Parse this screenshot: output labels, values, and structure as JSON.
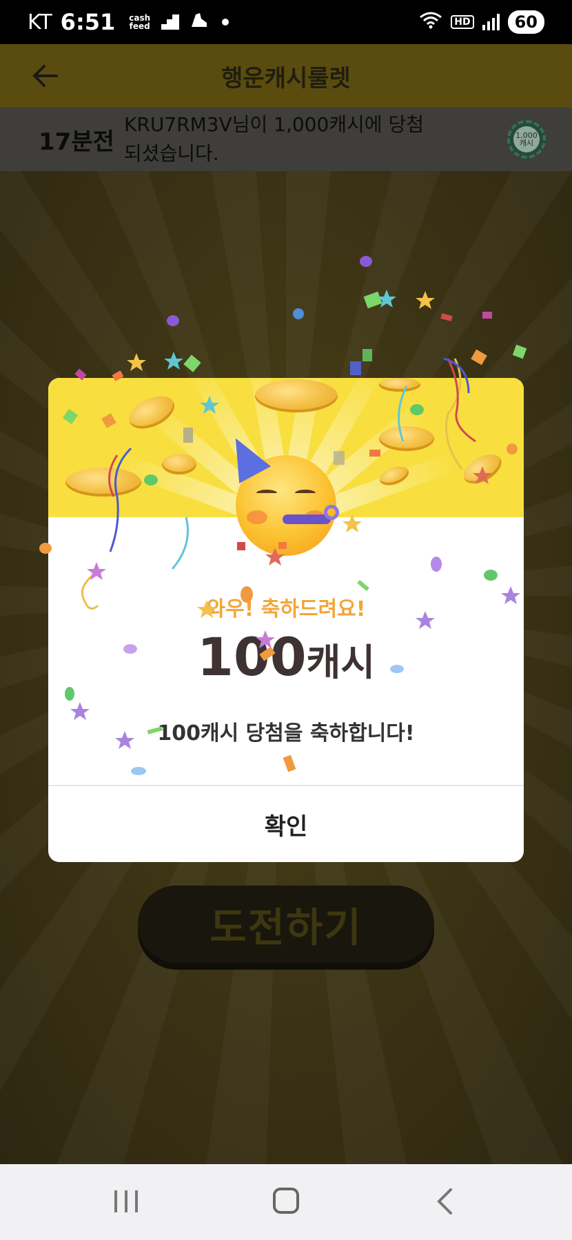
{
  "status_bar": {
    "carrier": "KT",
    "time": "6:51",
    "cashfeed_top": "cash",
    "cashfeed_bottom": "feed",
    "battery": "60",
    "hd": "HD"
  },
  "header": {
    "title": "행운캐시룰렛"
  },
  "ticker": {
    "time_ago": "17분전",
    "message": "KRU7RM3V님이 1,000캐시에 당첨되셨습니다.",
    "chip_label": "1,000 캐시"
  },
  "main": {
    "challenge_label": "도전하기"
  },
  "dialog": {
    "congrats": "와우! 축하드려요!",
    "amount_number": "100",
    "amount_unit": "캐시",
    "message": "100캐시 당첨을 축하합니다!",
    "confirm_label": "확인"
  },
  "colors": {
    "accent_yellow": "#f8df3f",
    "congrats_orange": "#f3a53a",
    "amount_text": "#3e3232"
  }
}
